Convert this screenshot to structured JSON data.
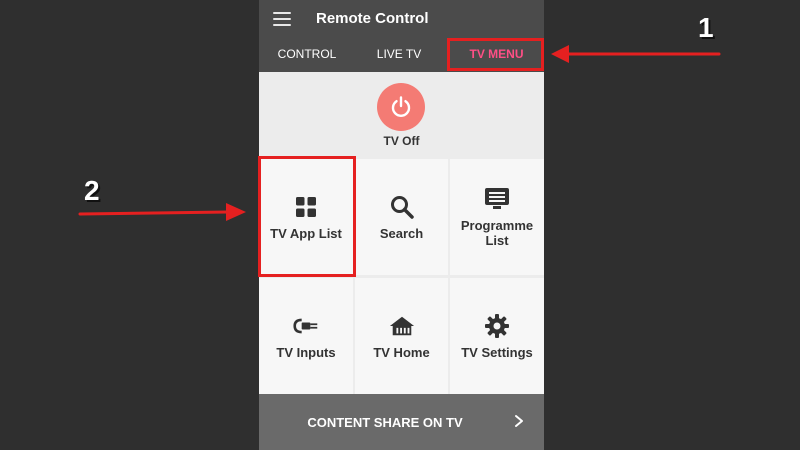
{
  "app": {
    "title": "Remote Control",
    "menu_icon": "hamburger-menu-icon"
  },
  "tabs": [
    {
      "label": "CONTROL",
      "active": false
    },
    {
      "label": "LIVE TV",
      "active": false
    },
    {
      "label": "TV MENU",
      "active": true
    }
  ],
  "power": {
    "label": "TV Off",
    "icon": "power-icon",
    "color": "#f47b74"
  },
  "menu_items": [
    {
      "label": "TV App List",
      "icon": "app-grid-icon"
    },
    {
      "label": "Search",
      "icon": "search-icon"
    },
    {
      "label": "Programme List",
      "icon": "programme-list-icon"
    },
    {
      "label": "TV Inputs",
      "icon": "input-plug-icon"
    },
    {
      "label": "TV Home",
      "icon": "home-icon"
    },
    {
      "label": "TV Settings",
      "icon": "gear-icon"
    }
  ],
  "share_bar": {
    "label": "CONTENT SHARE ON TV",
    "icon": "chevron-right-icon"
  },
  "annotations": [
    {
      "number": "1",
      "target": "TV MENU"
    },
    {
      "number": "2",
      "target": "TV App List"
    }
  ],
  "colors": {
    "accent": "#ff4f86",
    "highlight": "#e52020",
    "header": "#4b4b4b",
    "background": "#2f2f2f"
  }
}
